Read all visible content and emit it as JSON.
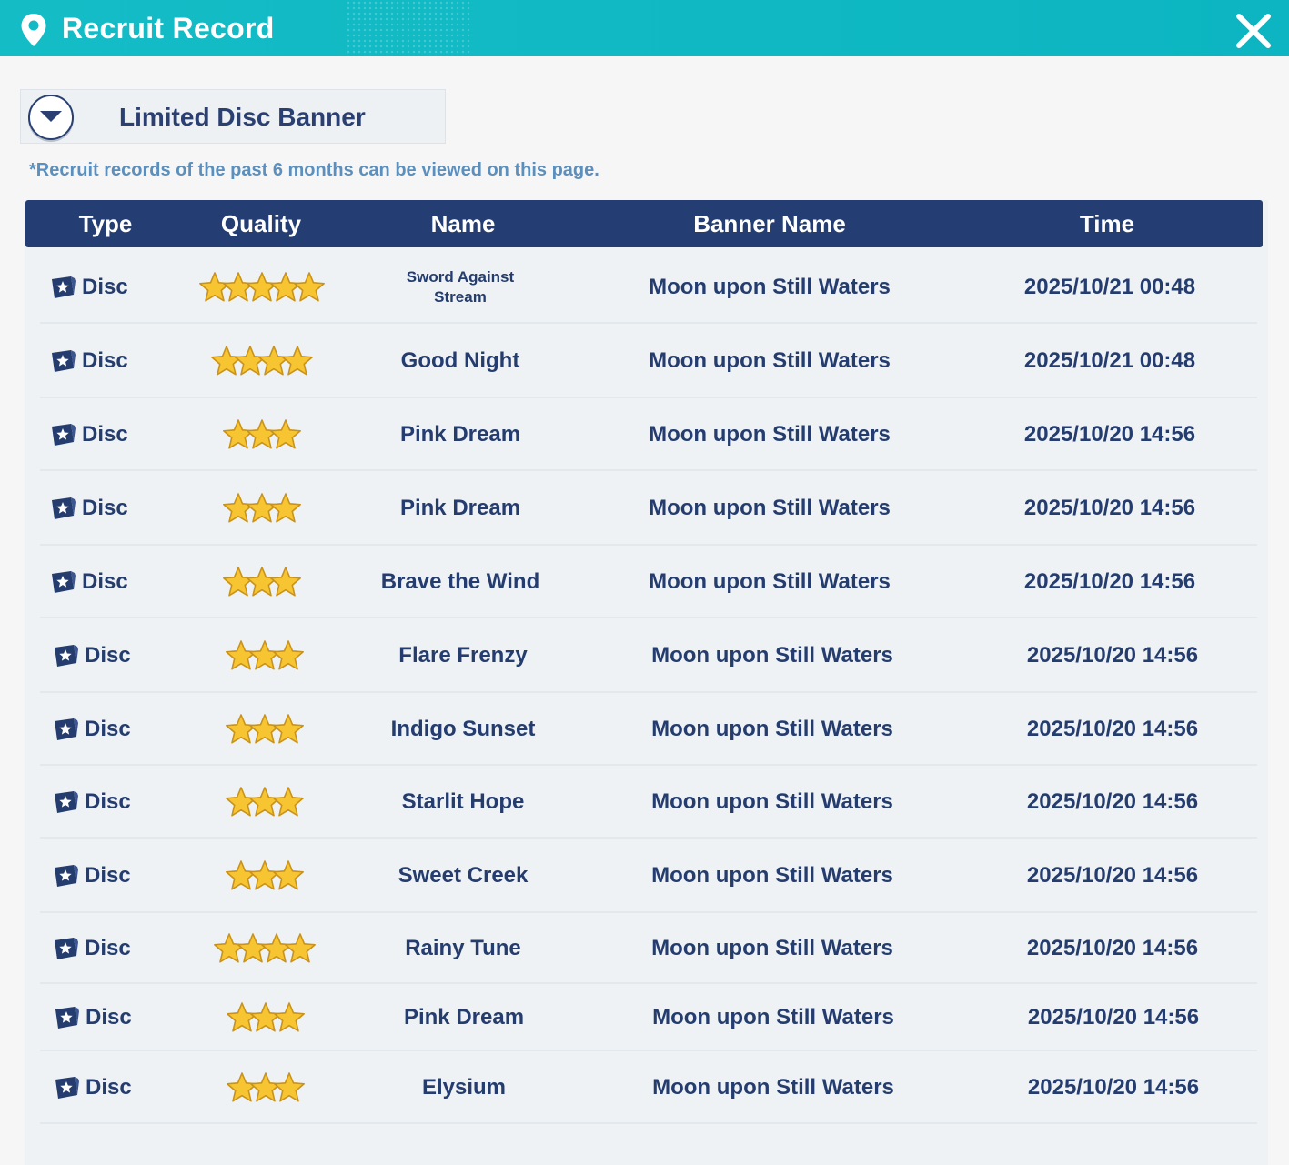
{
  "header": {
    "title": "Recruit Record"
  },
  "filter": {
    "selected": "Limited Disc Banner"
  },
  "note": "*Recruit records of the past 6 months can be viewed on this page.",
  "table": {
    "columns": [
      "Type",
      "Quality",
      "Name",
      "Banner Name",
      "Time"
    ],
    "rows": [
      {
        "type": "Disc",
        "stars": 5,
        "name": "Sword Against Stream",
        "banner": "Moon upon Still Waters",
        "time": "2025/10/21 00:48"
      },
      {
        "type": "Disc",
        "stars": 4,
        "name": "Good Night",
        "banner": "Moon upon Still Waters",
        "time": "2025/10/21 00:48"
      },
      {
        "type": "Disc",
        "stars": 3,
        "name": "Pink Dream",
        "banner": "Moon upon Still Waters",
        "time": "2025/10/20 14:56"
      },
      {
        "type": "Disc",
        "stars": 3,
        "name": "Pink Dream",
        "banner": "Moon upon Still Waters",
        "time": "2025/10/20 14:56"
      },
      {
        "type": "Disc",
        "stars": 3,
        "name": "Brave the Wind",
        "banner": "Moon upon Still Waters",
        "time": "2025/10/20 14:56"
      },
      {
        "type": "Disc",
        "stars": 3,
        "name": "Flare Frenzy",
        "banner": "Moon upon Still Waters",
        "time": "2025/10/20 14:56"
      },
      {
        "type": "Disc",
        "stars": 3,
        "name": "Indigo Sunset",
        "banner": "Moon upon Still Waters",
        "time": "2025/10/20 14:56"
      },
      {
        "type": "Disc",
        "stars": 3,
        "name": "Starlit Hope",
        "banner": "Moon upon Still Waters",
        "time": "2025/10/20 14:56"
      },
      {
        "type": "Disc",
        "stars": 3,
        "name": "Sweet Creek",
        "banner": "Moon upon Still Waters",
        "time": "2025/10/20 14:56"
      },
      {
        "type": "Disc",
        "stars": 4,
        "name": "Rainy Tune",
        "banner": "Moon upon Still Waters",
        "time": "2025/10/20 14:56"
      },
      {
        "type": "Disc",
        "stars": 3,
        "name": "Pink Dream",
        "banner": "Moon upon Still Waters",
        "time": "2025/10/20 14:56"
      },
      {
        "type": "Disc",
        "stars": 3,
        "name": "Elysium",
        "banner": "Moon upon Still Waters",
        "time": "2025/10/20 14:56"
      }
    ]
  },
  "icons": {
    "header": "location-pin-icon",
    "close": "close-icon",
    "dropdown": "chevron-down-icon",
    "type": "disc-icon",
    "quality": "star-icon"
  },
  "colors": {
    "header": "#12bac5",
    "table_header": "#243e73",
    "text": "#243c6e",
    "note": "#5b8fbd",
    "star": "#f7c531"
  }
}
